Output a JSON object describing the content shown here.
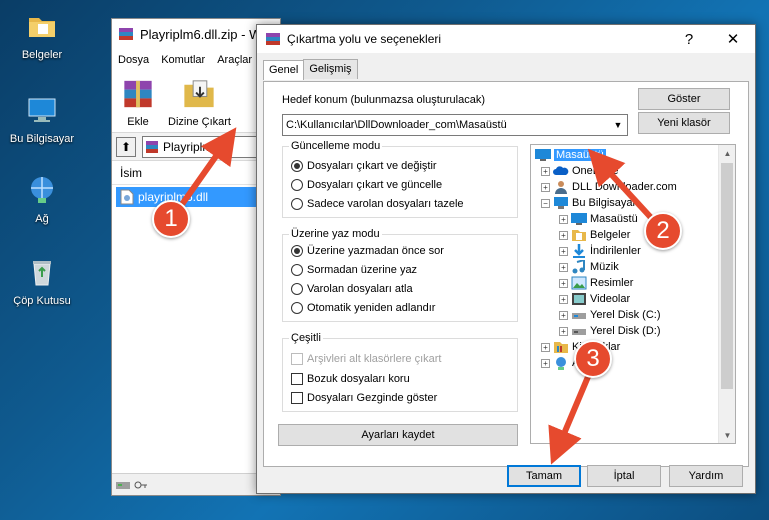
{
  "desktop": {
    "icons": [
      {
        "label": "Belgeler",
        "icon": "folder-icon"
      },
      {
        "label": "Bu Bilgisayar",
        "icon": "computer-icon"
      },
      {
        "label": "Ağ",
        "icon": "network-icon"
      },
      {
        "label": "Çöp Kutusu",
        "icon": "recycle-bin-icon"
      }
    ]
  },
  "rar_window": {
    "title": "Playriplm6.dll.zip - W",
    "menu": [
      "Dosya",
      "Komutlar",
      "Araçlar"
    ],
    "toolbar": {
      "add_label": "Ekle",
      "extract_label": "Dizine Çıkart"
    },
    "path_text": "Playriplm6",
    "list_header": "İsim",
    "file_name": "playriplm6.dll"
  },
  "dialog": {
    "title": "Çıkartma yolu ve seçenekleri",
    "help_glyph": "?",
    "close_glyph": "✕",
    "tabs": [
      "Genel",
      "Gelişmiş"
    ],
    "destination_label": "Hedef konum (bulunmazsa oluşturulacak)",
    "destination_value": "C:\\Kullanıcılar\\DllDownloader_com\\Masaüstü",
    "show_button": "Göster",
    "new_folder_button": "Yeni klasör",
    "update_mode": {
      "title": "Güncelleme modu",
      "options": [
        {
          "label": "Dosyaları çıkart ve değiştir",
          "selected": true
        },
        {
          "label": "Dosyaları çıkart ve güncelle",
          "selected": false
        },
        {
          "label": "Sadece varolan dosyaları tazele",
          "selected": false
        }
      ]
    },
    "overwrite_mode": {
      "title": "Üzerine yaz modu",
      "options": [
        {
          "label": "Üzerine yazmadan önce sor",
          "selected": true
        },
        {
          "label": "Sormadan üzerine yaz",
          "selected": false
        },
        {
          "label": "Varolan dosyaları atla",
          "selected": false
        },
        {
          "label": "Otomatik yeniden adlandır",
          "selected": false
        }
      ]
    },
    "misc": {
      "title": "Çeşitli",
      "options": [
        {
          "label": "Arşivleri alt klasörlere çıkart",
          "checked": false,
          "disabled": true
        },
        {
          "label": "Bozuk dosyaları koru",
          "checked": false,
          "disabled": false
        },
        {
          "label": "Dosyaları Gezginde göster",
          "checked": false,
          "disabled": false
        }
      ]
    },
    "save_settings_button": "Ayarları kaydet",
    "tree": [
      {
        "label": "Masaüstü",
        "icon": "desktop-icon",
        "selected": true
      },
      {
        "label": "OneDrive",
        "icon": "cloud-icon",
        "selected": false
      },
      {
        "label": "DLL Downloader.com",
        "icon": "user-icon",
        "selected": false
      },
      {
        "label": "Bu Bilgisayar",
        "icon": "computer-icon",
        "selected": false
      },
      {
        "label": "Masaüstü",
        "icon": "desktop-icon",
        "selected": false
      },
      {
        "label": "Belgeler",
        "icon": "documents-icon",
        "selected": false
      },
      {
        "label": "İndirilenler",
        "icon": "download-icon",
        "selected": false
      },
      {
        "label": "Müzik",
        "icon": "music-icon",
        "selected": false
      },
      {
        "label": "Resimler",
        "icon": "pictures-icon",
        "selected": false
      },
      {
        "label": "Videolar",
        "icon": "videos-icon",
        "selected": false
      },
      {
        "label": "Yerel Disk (C:)",
        "icon": "drive-icon",
        "selected": false
      },
      {
        "label": "Yerel Disk (D:)",
        "icon": "drive-icon",
        "selected": false
      },
      {
        "label": "Kitaplıklar",
        "icon": "library-icon",
        "selected": false
      },
      {
        "label": "Ağ",
        "icon": "network-icon",
        "selected": false
      }
    ],
    "ok_button": "Tamam",
    "cancel_button": "İptal",
    "help_button": "Yardım"
  },
  "annotations": [
    "1",
    "2",
    "3"
  ],
  "colors": {
    "marker": "#e64a2e",
    "selection": "#3399ff",
    "accent": "#0078d7"
  }
}
